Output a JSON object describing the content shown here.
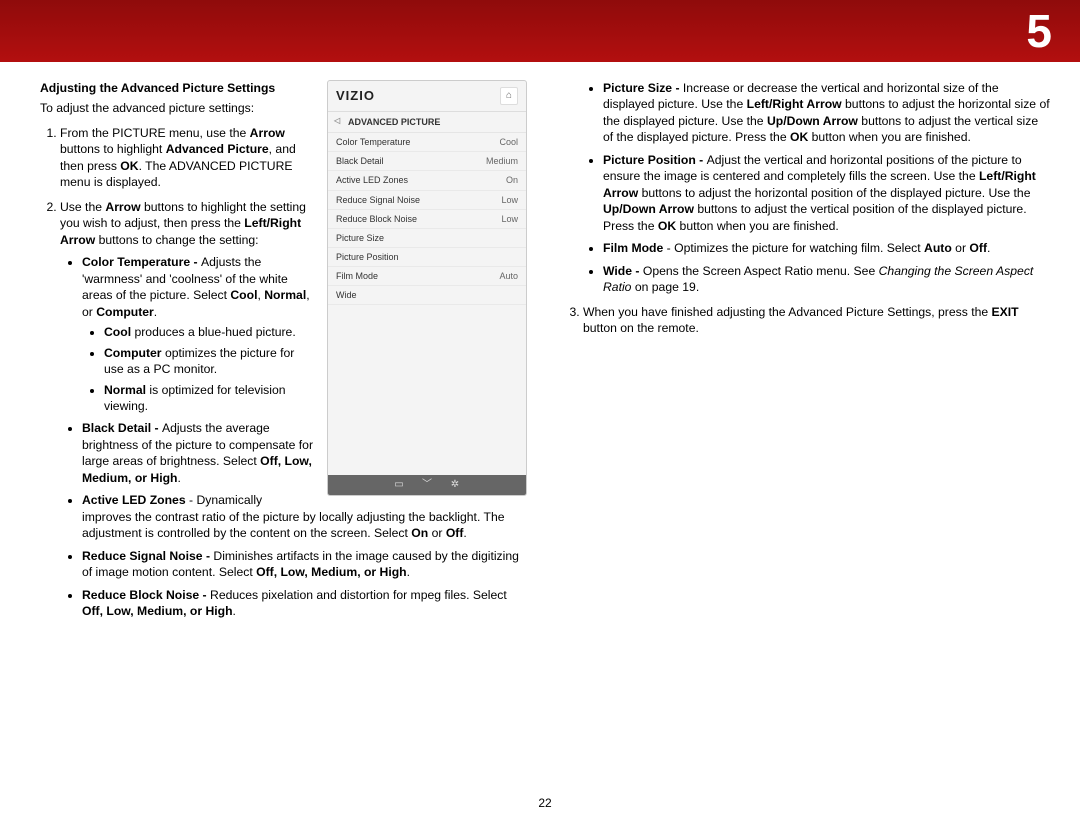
{
  "chapter_number": "5",
  "page_number": "22",
  "left": {
    "title": "Adjusting the Advanced Picture Settings",
    "intro": "To adjust the advanced picture settings:",
    "step1_a": "From the PICTURE menu, use the ",
    "step1_b": " buttons to highlight ",
    "step1_c": ", and then press ",
    "step1_d": ". The ADVANCED PICTURE menu is displayed.",
    "b_arrow": "Arrow",
    "b_advpic": "Advanced Picture",
    "b_ok": "OK",
    "step2_a": "Use the ",
    "step2_b": " buttons to highlight the setting you wish to adjust, then press the ",
    "step2_c": " buttons to change the setting:",
    "b_lrarrow": "Left/Right Arrow",
    "ct": {
      "head": "Color Temperature - ",
      "body_a": "Adjusts the 'warmness' and 'coolness' of the white areas of the picture. Select ",
      "b_cool": "Cool",
      "comma1": ", ",
      "b_normal": "Normal",
      "comma2": ", or ",
      "b_computer": "Computer",
      "period": ".",
      "sub_cool_a": "Cool",
      "sub_cool_b": " produces a blue-hued picture.",
      "sub_comp_a": "Computer",
      "sub_comp_b": " optimizes the picture for use as a PC monitor.",
      "sub_norm_a": "Normal",
      "sub_norm_b": " is optimized for television viewing."
    },
    "bd": {
      "head": "Black Detail - ",
      "body": "Adjusts the average brightness of the picture to compensate for large areas of brightness. Select ",
      "opts": "Off, Low, Medium, or High",
      "period": "."
    },
    "led": {
      "head": "Active LED Zones",
      "body": " - Dynamically improves the contrast ratio of the picture by locally adjusting the backlight. The adjustment is controlled by the content on the screen. Select ",
      "b_on": "On",
      "or": " or ",
      "b_off": "Off",
      "period": "."
    },
    "rsn": {
      "head": "Reduce Signal Noise - ",
      "body": "Diminishes artifacts in the image caused by the digitizing of image motion content. Select ",
      "opts": "Off, Low, Medium, or High",
      "period": "."
    },
    "rbn": {
      "head": "Reduce Block Noise - ",
      "body": "Reduces pixelation and distortion for mpeg files. Select ",
      "opts": "Off, Low, Medium, or High",
      "period": "."
    }
  },
  "right": {
    "ps": {
      "head": "Picture Size - ",
      "a": "Increase or decrease the vertical and horizontal size of the displayed picture. Use the ",
      "b_lr": "Left/Right Arrow",
      "b": " buttons to adjust the horizontal size of the displayed picture. Use the ",
      "b_ud": "Up/Down Arrow",
      "c": " buttons to adjust the vertical size of the displayed picture. Press the ",
      "b_ok": "OK",
      "d": " button when you are finished."
    },
    "pp": {
      "head": "Picture Position - ",
      "a": "Adjust the vertical and horizontal positions of the picture to ensure the image is centered and completely fills the screen. Use the ",
      "b_lr": "Left/Right Arrow",
      "b": " buttons to adjust the horizontal position of the displayed picture. Use the ",
      "b_ud": "Up/Down Arrow",
      "c": " buttons to adjust the vertical position of the displayed picture. Press the ",
      "b_ok": "OK",
      "d": " button when you are finished."
    },
    "fm": {
      "head": "Film Mode",
      "a": " - Optimizes the picture for watching film. Select ",
      "b_auto": "Auto",
      "or": " or ",
      "b_off": "Off",
      "period": "."
    },
    "wide": {
      "head": "Wide - ",
      "a": "Opens the Screen Aspect Ratio menu. See ",
      "iref": "Changing the Screen Aspect Ratio",
      "b": " on page 19."
    },
    "step3_a": "When you have finished adjusting the Advanced Picture Settings, press the ",
    "b_exit": "EXIT",
    "step3_b": " button on the remote."
  },
  "menu": {
    "logo": "VIZIO",
    "title": "ADVANCED PICTURE",
    "rows": [
      {
        "label": "Color Temperature",
        "value": "Cool"
      },
      {
        "label": "Black Detail",
        "value": "Medium"
      },
      {
        "label": "Active LED Zones",
        "value": "On"
      },
      {
        "label": "Reduce Signal Noise",
        "value": "Low"
      },
      {
        "label": "Reduce Block Noise",
        "value": "Low"
      },
      {
        "label": "Picture Size",
        "value": ""
      },
      {
        "label": "Picture Position",
        "value": ""
      },
      {
        "label": "Film Mode",
        "value": "Auto"
      },
      {
        "label": "Wide",
        "value": ""
      }
    ]
  }
}
